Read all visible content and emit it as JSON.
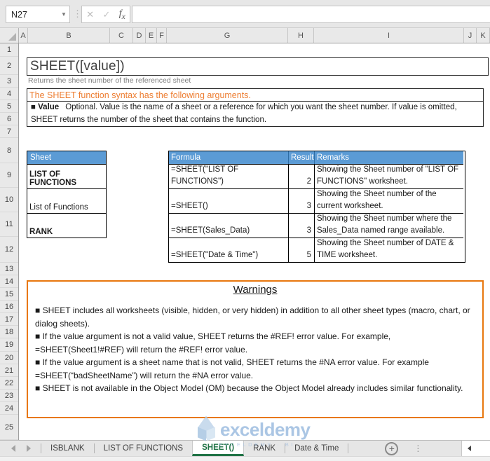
{
  "colors": {
    "accent_blue": "#5B9BD5",
    "accent_orange": "#ED7D31",
    "accent_green": "#217346",
    "watermark_blue": "#8FB4DC"
  },
  "name_box": {
    "value": "N27"
  },
  "formula_bar": {
    "value": ""
  },
  "grid": {
    "columns": [
      "A",
      "B",
      "C",
      "D",
      "E",
      "F",
      "G",
      "H",
      "I",
      "J",
      "K"
    ],
    "rows": [
      "1",
      "2",
      "3",
      "4",
      "5",
      "6",
      "7",
      "8",
      "9",
      "10",
      "11",
      "12",
      "13",
      "14",
      "15",
      "16",
      "17",
      "18",
      "19",
      "20",
      "21",
      "22",
      "23",
      "24",
      "25"
    ]
  },
  "doc": {
    "title": "SHEET([value])",
    "subtitle": "Returns the sheet number of the referenced sheet",
    "syntax_heading": "The SHEET function syntax has the following arguments.",
    "arg_label": "■ Value",
    "arg_desc": "Optional. Value is the name of a sheet or a reference for which you want the sheet number. If value is omitted, SHEET returns the number of the sheet that contains the function."
  },
  "sheet_table": {
    "header": "Sheet",
    "rows": [
      {
        "text": "LIST OF FUNCTIONS"
      },
      {
        "text": "List of Functions"
      },
      {
        "text": "RANK"
      }
    ]
  },
  "formula_table": {
    "headers": [
      "Formula",
      "Result",
      "Remarks"
    ],
    "rows": [
      {
        "formula": "=SHEET(\"LIST OF FUNCTIONS\")",
        "result": "2",
        "remarks": "Showing the Sheet number of \"LIST OF FUNCTIONS\" worksheet."
      },
      {
        "formula": "=SHEET()",
        "result": "3",
        "remarks": "Showing the Sheet number of the current worksheet."
      },
      {
        "formula": "=SHEET(Sales_Data)",
        "result": "3",
        "remarks": "Showing the Sheet number where the Sales_Data named range available."
      },
      {
        "formula": "=SHEET(\"Date & Time\")",
        "result": "5",
        "remarks": "Showing the Sheet number of DATE & TIME worksheet."
      }
    ]
  },
  "warnings": {
    "title": "Warnings",
    "items": [
      "■ SHEET includes all worksheets (visible, hidden, or very hidden) in addition to all other sheet types (macro, chart, or dialog sheets).",
      "■ If the value argument is not a valid value, SHEET returns the #REF! error value. For example, =SHEET(Sheet1!#REF) will return the #REF! error value.",
      "■ If the value argument is a sheet name that is not valid, SHEET returns the #NA error value. For example =SHEET(“badSheetName”) will return the #NA error value.",
      "■ SHEET is not available in the Object Model (OM) because the Object Model already includes similar functionality."
    ]
  },
  "tabs": {
    "items": [
      {
        "label": "ISBLANK",
        "active": false
      },
      {
        "label": "LIST OF FUNCTIONS",
        "active": false
      },
      {
        "label": "SHEET()",
        "active": true
      },
      {
        "label": "RANK",
        "active": false
      },
      {
        "label": "Date & Time",
        "active": false
      }
    ]
  },
  "watermark": {
    "text": "exceldemy",
    "tagline": "EXCELDEMY · BI"
  }
}
